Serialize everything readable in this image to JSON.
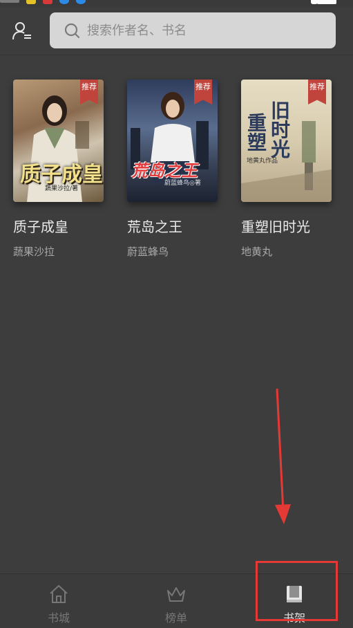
{
  "header": {
    "search": {
      "placeholder": "搜索作者名、书名"
    },
    "icons": {
      "user": "user-menu-icon",
      "search": "search-icon"
    }
  },
  "books": [
    {
      "title": "质子成皇",
      "author": "蔬果沙拉",
      "badge": "推荐",
      "cover_title": "质子成皇",
      "cover_author": "蔬果沙拉/著"
    },
    {
      "title": "荒岛之王",
      "author": "蔚蓝蜂鸟",
      "badge": "推荐",
      "cover_title": "荒岛之王",
      "cover_author": "蔚蓝蜂鸟◎著"
    },
    {
      "title": "重塑旧时光",
      "author": "地黄丸",
      "badge": "推荐",
      "cover_title_a": "旧时光",
      "cover_title_b": "重塑",
      "cover_author": "地黄丸作品"
    }
  ],
  "bottom_nav": [
    {
      "label": "书城",
      "icon": "home-icon",
      "active": false
    },
    {
      "label": "榜单",
      "icon": "crown-icon",
      "active": false
    },
    {
      "label": "书架",
      "icon": "bookshelf-icon",
      "active": true
    }
  ],
  "colors": {
    "annotation": "#e53935",
    "badge": "#c0443c",
    "background": "#3d3d3d"
  }
}
